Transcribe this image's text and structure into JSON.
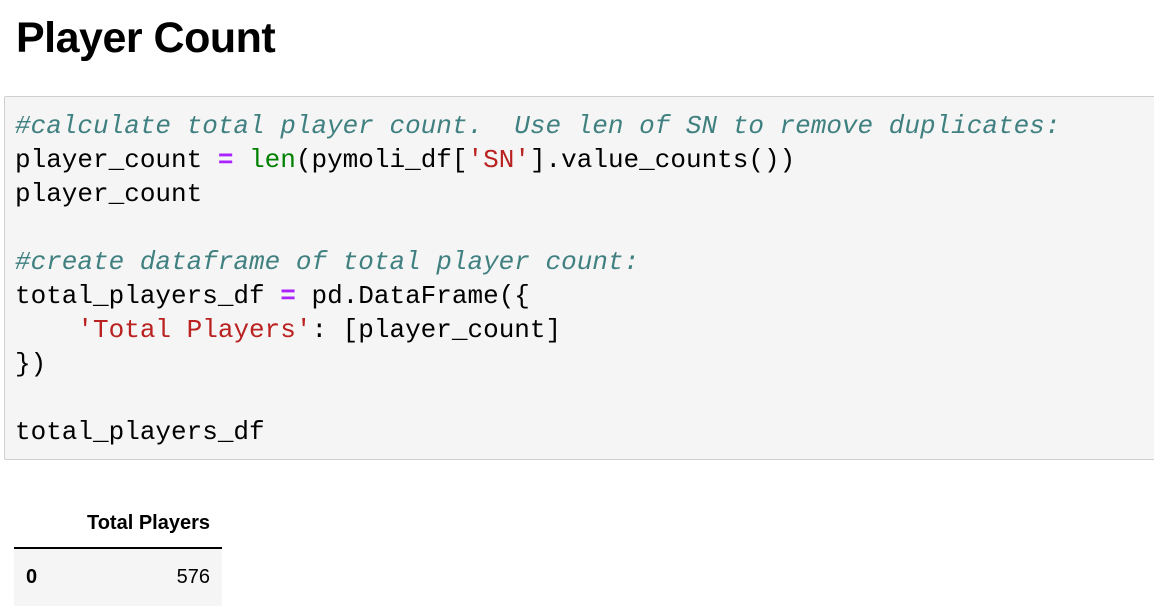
{
  "page": {
    "heading": "Player Count"
  },
  "code_cell": {
    "lines": [
      [
        {
          "t": "cm",
          "v": "#calculate total player count.  Use len of SN to remove duplicates:"
        }
      ],
      [
        {
          "t": "n",
          "v": "player_count "
        },
        {
          "t": "op",
          "v": "="
        },
        {
          "t": "n",
          "v": " "
        },
        {
          "t": "bi",
          "v": "len"
        },
        {
          "t": "n",
          "v": "(pymoli_df["
        },
        {
          "t": "st",
          "v": "'SN'"
        },
        {
          "t": "n",
          "v": "].value_counts())"
        }
      ],
      [
        {
          "t": "n",
          "v": "player_count"
        }
      ],
      [],
      [
        {
          "t": "cm",
          "v": "#create dataframe of total player count:"
        }
      ],
      [
        {
          "t": "n",
          "v": "total_players_df "
        },
        {
          "t": "op",
          "v": "="
        },
        {
          "t": "n",
          "v": " pd.DataFrame({"
        }
      ],
      [
        {
          "t": "n",
          "v": "    "
        },
        {
          "t": "st",
          "v": "'Total Players'"
        },
        {
          "t": "n",
          "v": ": [player_count]"
        }
      ],
      [
        {
          "t": "n",
          "v": "})"
        }
      ],
      [],
      [
        {
          "t": "n",
          "v": "total_players_df"
        }
      ]
    ],
    "colors": {
      "comment": "#408080",
      "operator": "#aa22ff",
      "builtin": "#008000",
      "string": "#ba2121",
      "background": "#f5f5f5"
    }
  },
  "output_table": {
    "index_header": "",
    "columns": [
      "Total Players"
    ],
    "rows": [
      {
        "index": "0",
        "values": [
          "576"
        ]
      }
    ]
  }
}
